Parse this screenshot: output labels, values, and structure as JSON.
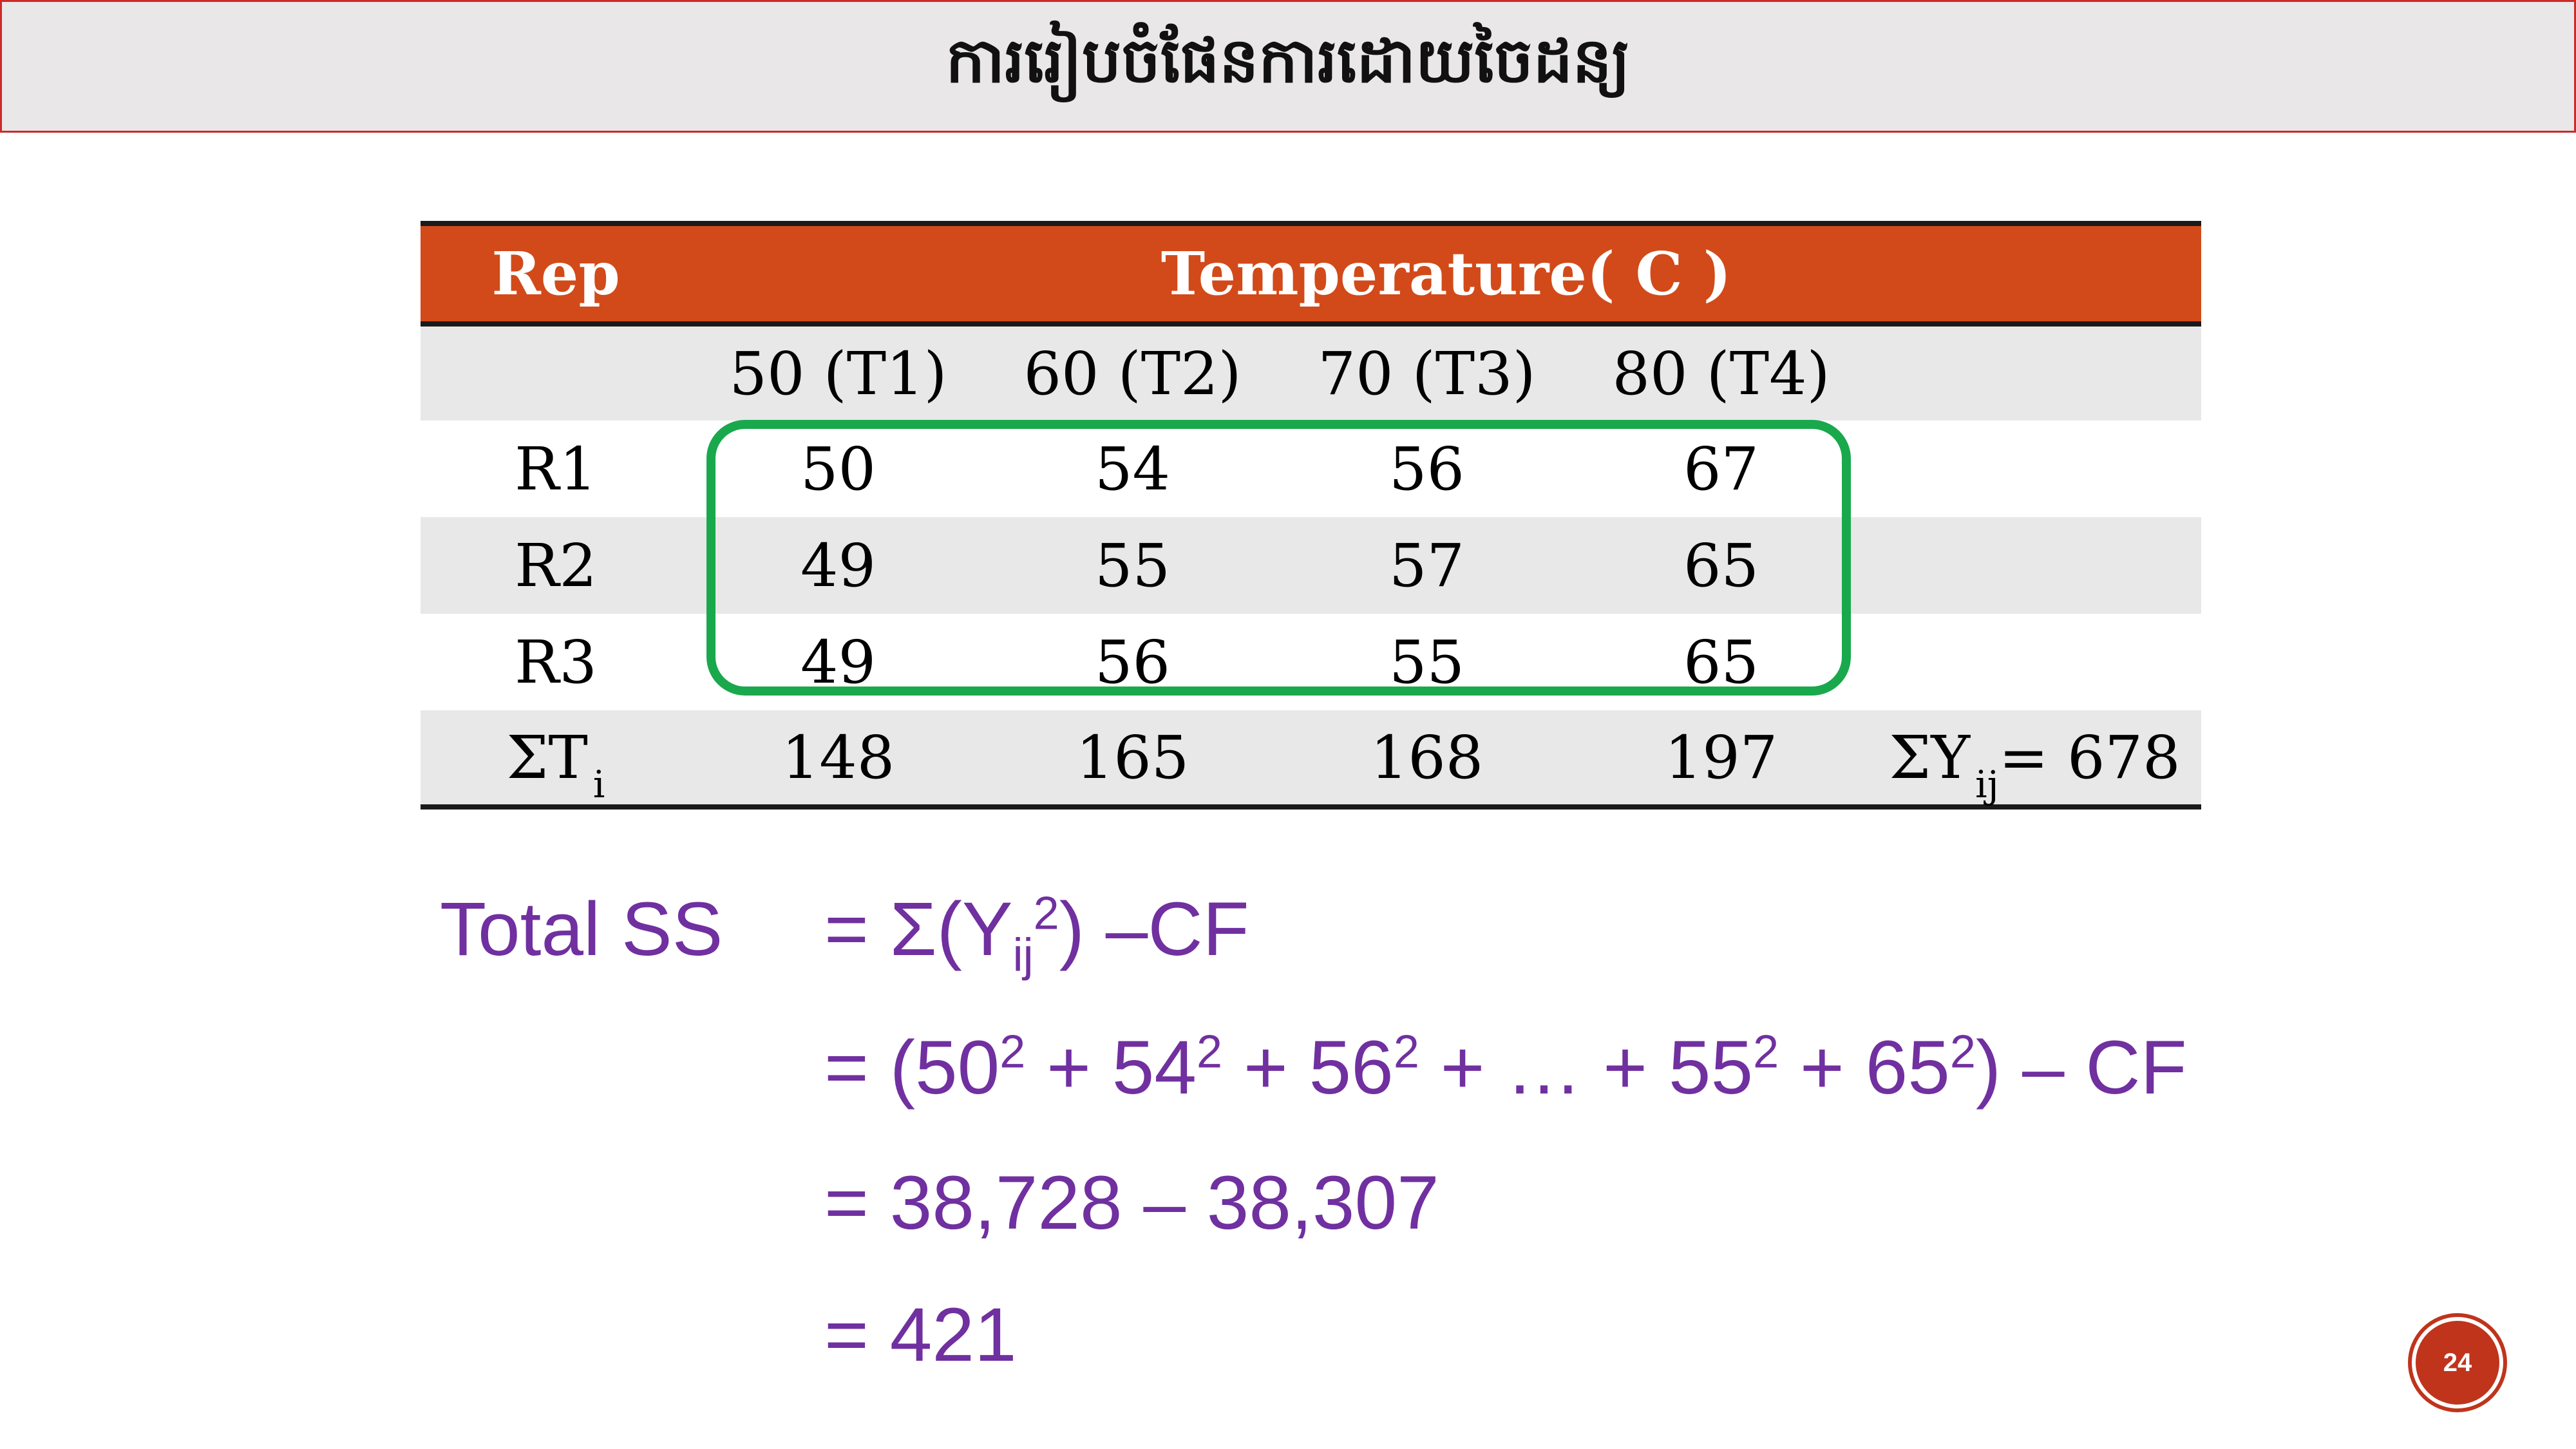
{
  "title": "ការរៀបចំផែនការដោយចៃដន្យ",
  "table": {
    "header_rep": "Rep",
    "header_group": "Temperature( C )",
    "treatments": [
      "50 (T1)",
      "60 (T2)",
      "70 (T3)",
      "80 (T4)"
    ],
    "rows": [
      {
        "label": "R1",
        "values": [
          "50",
          "54",
          "56",
          "67"
        ]
      },
      {
        "label": "R2",
        "values": [
          "49",
          "55",
          "57",
          "65"
        ]
      },
      {
        "label": "R3",
        "values": [
          "49",
          "56",
          "55",
          "65"
        ]
      }
    ],
    "totals": {
      "label": "ΣT",
      "label_sub": "i",
      "values": [
        "148",
        "165",
        "168",
        "197"
      ],
      "grand_label": "ΣY",
      "grand_sub": "ij",
      "grand_value": "= 678"
    }
  },
  "formula": {
    "label": "Total SS",
    "line1": {
      "a": "= Σ(Y",
      "sub": "ij",
      "sup": "2",
      "b": ") –CF"
    },
    "line2": {
      "open": "= (50",
      "p2": " + 54",
      "p3": " + 56",
      "p4": " + … + 55",
      "p5": " + 65",
      "close": ") – CF",
      "exp": "2"
    },
    "line3": "= 38,728 – 38,307",
    "line4": "= 421"
  },
  "page_number": "24",
  "colors": {
    "header_bg": "#d24a19",
    "formula_text": "#7030a0",
    "highlight_box": "#1aa84c",
    "badge": "#c0341c"
  }
}
